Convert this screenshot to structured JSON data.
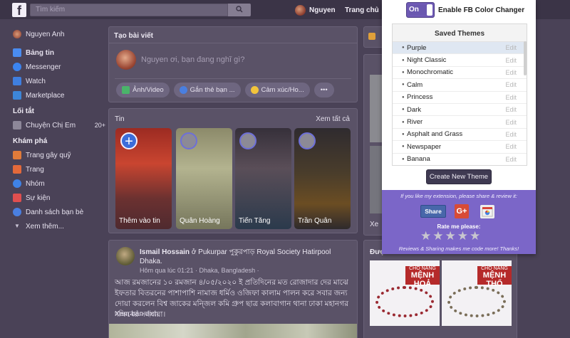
{
  "topbar": {
    "logo": "f",
    "search_placeholder": "Tìm kiếm",
    "user_name": "Nguyen",
    "home_label": "Trang chủ"
  },
  "left_nav": {
    "profile_name": "Nguyen Anh",
    "items": [
      {
        "label": "Bảng tin",
        "icon": "news-feed-icon",
        "color": "#4a8cf0"
      },
      {
        "label": "Messenger",
        "icon": "messenger-icon",
        "color": "#3b84f0"
      },
      {
        "label": "Watch",
        "icon": "watch-icon",
        "color": "#3f7fe0"
      },
      {
        "label": "Marketplace",
        "icon": "marketplace-icon",
        "color": "#3d86d8"
      }
    ],
    "shortcuts_heading": "Lối tắt",
    "shortcut": {
      "label": "Chuyện Chị Em",
      "count": "20+"
    },
    "explore_heading": "Khám phá",
    "explore_items": [
      {
        "label": "Trang gây quỹ",
        "icon": "fundraiser-icon",
        "color": "#e07b3a"
      },
      {
        "label": "Trang",
        "icon": "flag-icon",
        "color": "#e4693a"
      },
      {
        "label": "Nhóm",
        "icon": "groups-icon",
        "color": "#3f82e6"
      },
      {
        "label": "Sự kiện",
        "icon": "events-icon",
        "color": "#e04f4f"
      },
      {
        "label": "Danh sách bạn bè",
        "icon": "friends-list-icon",
        "color": "#4a7fe0"
      }
    ],
    "see_more": "Xem thêm..."
  },
  "composer": {
    "title": "Tạo bài viết",
    "placeholder": "Nguyen ơi, bạn đang nghĩ gì?",
    "actions": [
      {
        "label": "Ảnh/Video",
        "icon": "photo-icon",
        "color": "#4ab46a"
      },
      {
        "label": "Gắn thẻ bạn ...",
        "icon": "tag-friends-icon",
        "color": "#4a7fe0"
      },
      {
        "label": "Cảm xúc/Ho...",
        "icon": "feeling-icon",
        "color": "#f2c43b"
      }
    ],
    "more": "•••"
  },
  "stories": {
    "title": "Tin",
    "see_all": "Xem tất cả",
    "items": [
      {
        "name": "Thêm vào tin"
      },
      {
        "name": "Quân Hoàng"
      },
      {
        "name": "Tiến Tăng"
      },
      {
        "name": "Trần Quân"
      }
    ]
  },
  "post": {
    "author": "Ismail Hossain",
    "location_text": "ở Pukurpar পুকুরপাড় Royal Society Hatirpool Dhaka.",
    "meta": "Hôm qua lúc 01:21 · Dhaka, Bangladesh ·",
    "body": "আজ রমজানের ১০ রমজান ৪/০৫/২০২০ ই প্রতিদিনের মত রোজাদার দের মাঝে ইফতার বিতরনের পাশাপাশি নামাজ ধর্মিও ওজিফা কালাম পালন করে সবার জন্য দোয়া করলেন বিশ্ব জাকের মন্জিল কমি গ্রুপ ছাত্র কলাবাগান থানা ঢাকা মহানগর দক্ষিনের সদস্যরা।",
    "translate": "Xem bản dịch"
  },
  "right_col": {
    "sponsored_title": "Đượ",
    "promos": [
      {
        "line1": "CHO NÀNG",
        "line2": "MỆNH HOẢ"
      },
      {
        "line1": "CHO NÀNG",
        "line2": "MỆNH THỔ"
      }
    ],
    "side_label": "Xe"
  },
  "extension": {
    "toggle_state": "On",
    "toggle_label": "Enable FB Color Changer",
    "saved_title": "Saved Themes",
    "themes": [
      {
        "name": "Purple",
        "edit": "Edit",
        "selected": true
      },
      {
        "name": "Night Classic",
        "edit": "Edit"
      },
      {
        "name": "Monochromatic",
        "edit": "Edit"
      },
      {
        "name": "Calm",
        "edit": "Edit"
      },
      {
        "name": "Princess",
        "edit": "Edit"
      },
      {
        "name": "Dark",
        "edit": "Edit"
      },
      {
        "name": "River",
        "edit": "Edit"
      },
      {
        "name": "Asphalt and Grass",
        "edit": "Edit"
      },
      {
        "name": "Newspaper",
        "edit": "Edit"
      },
      {
        "name": "Banana",
        "edit": "Edit"
      }
    ],
    "create_button": "Create New Theme",
    "share_prompt": "If you like my extension, please share & review it:",
    "share_button": "Share",
    "gplus": "G+",
    "rate_label": "Rate me please:",
    "rating": 0,
    "stars": "★★★★★",
    "reviews_note": "Reviews & Sharing makes me code more! Thanks!",
    "accent": "#7b66c8"
  }
}
